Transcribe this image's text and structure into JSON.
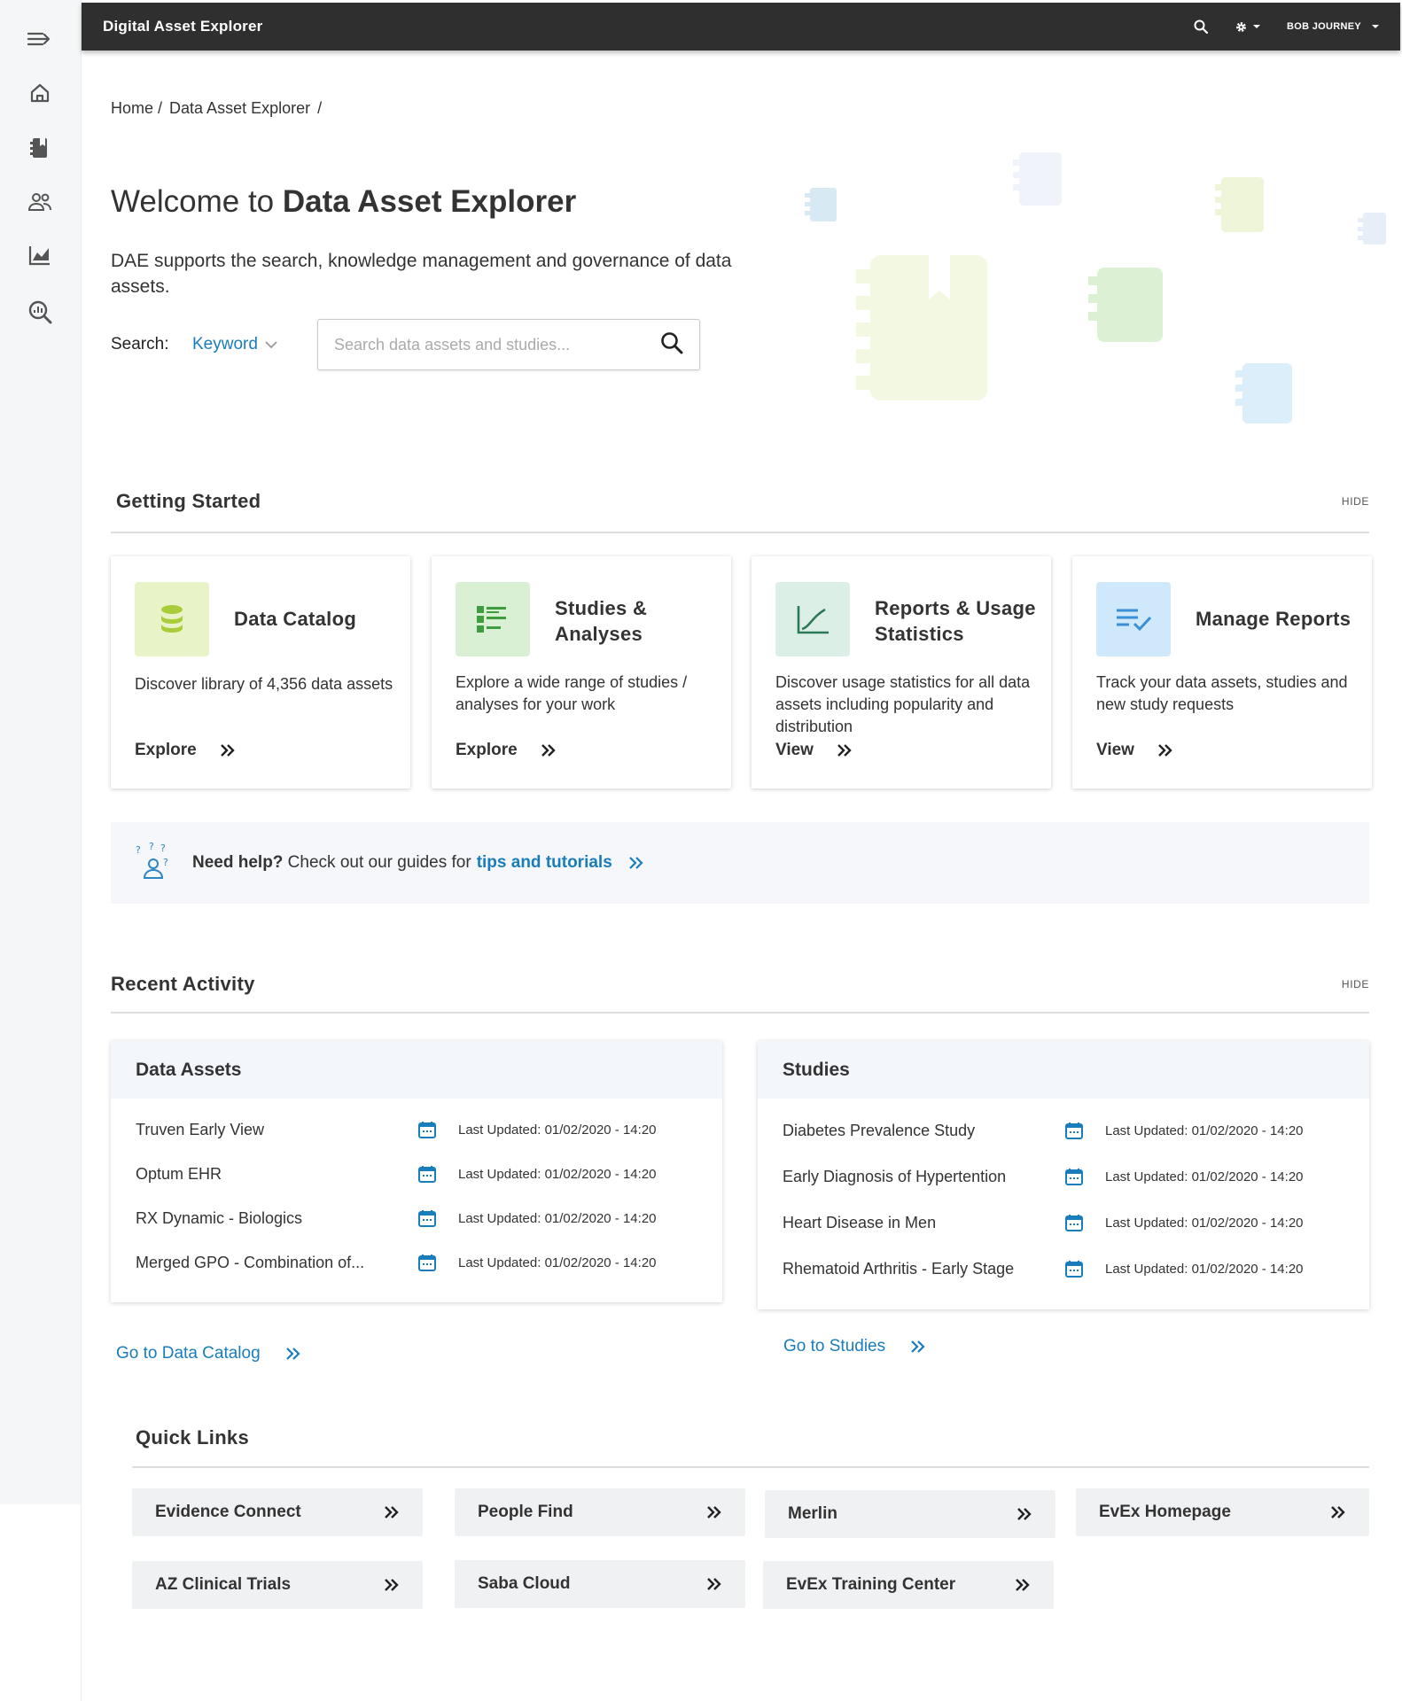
{
  "app": {
    "title": "Digital Asset Explorer",
    "user": "BOB JOURNEY"
  },
  "sidebar": {
    "items": [
      {
        "icon": "menu-expand-icon"
      },
      {
        "icon": "home-icon"
      },
      {
        "icon": "catalog-icon"
      },
      {
        "icon": "people-icon"
      },
      {
        "icon": "chart-icon"
      },
      {
        "icon": "analytics-search-icon"
      }
    ]
  },
  "breadcrumb": {
    "home": "Home /",
    "current": "Data Asset Explorer",
    "sep": "/"
  },
  "hero": {
    "welcome_prefix": "Welcome to ",
    "welcome_bold": "Data Asset Explorer",
    "intro": "DAE supports the search, knowledge management and governance of data assets."
  },
  "search": {
    "label": "Search:",
    "mode": "Keyword",
    "placeholder": "Search data assets and studies..."
  },
  "getting_started": {
    "title": "Getting Started",
    "hide": "HIDE",
    "cards": [
      {
        "title": "Data Catalog",
        "desc": "Discover library of 4,356 data assets",
        "action": "Explore",
        "icon_bg": "#e8f4c8"
      },
      {
        "title": "Studies & Analyses",
        "desc": "Explore a wide range of studies / analyses for your work",
        "action": "Explore",
        "icon_bg": "#d9f0d4"
      },
      {
        "title": "Reports & Usage Statistics",
        "desc": "Discover usage statistics for all data assets including popularity and distribution",
        "action": "View",
        "icon_bg": "#dcefe6"
      },
      {
        "title": "Manage Reports",
        "desc": "Track your data assets, studies and new study requests",
        "action": "View",
        "icon_bg": "#cfe8fb"
      }
    ]
  },
  "help": {
    "bold": "Need help?",
    "text": " Check out our guides for",
    "link": "tips and tutorials"
  },
  "recent": {
    "title": "Recent Activity",
    "hide": "HIDE",
    "assets": {
      "title": "Data Assets",
      "rows": [
        {
          "name": "Truven Early View",
          "date": "Last Updated: 01/02/2020  - 14:20"
        },
        {
          "name": "Optum EHR",
          "date": "Last Updated: 01/02/2020  - 14:20"
        },
        {
          "name": "RX Dynamic - Biologics",
          "date": "Last Updated: 01/02/2020  - 14:20"
        },
        {
          "name": "Merged GPO - Combination of...",
          "date": "Last Updated: 01/02/2020  - 14:20"
        }
      ],
      "goto": "Go to Data Catalog"
    },
    "studies": {
      "title": "Studies",
      "rows": [
        {
          "name": "Diabetes Prevalence Study",
          "date": "Last Updated: 01/02/2020  - 14:20"
        },
        {
          "name": "Early Diagnosis of Hypertention",
          "date": "Last Updated: 01/02/2020  - 14:20"
        },
        {
          "name": "Heart Disease in Men",
          "date": "Last Updated: 01/02/2020  - 14:20"
        },
        {
          "name": "Rhematoid Arthritis - Early Stage",
          "date": "Last Updated: 01/02/2020  - 14:20"
        }
      ],
      "goto": "Go to Studies"
    }
  },
  "quick_links": {
    "title": "Quick Links",
    "items": [
      "Evidence Connect",
      "People Find",
      "Merlin",
      "EvEx Homepage",
      "AZ Clinical Trials",
      "Saba Cloud",
      "EvEx Training Center"
    ]
  },
  "colors": {
    "accent": "#1a7dbb",
    "topbar": "#2f2f2f",
    "panel_head": "#f3f6fb"
  }
}
